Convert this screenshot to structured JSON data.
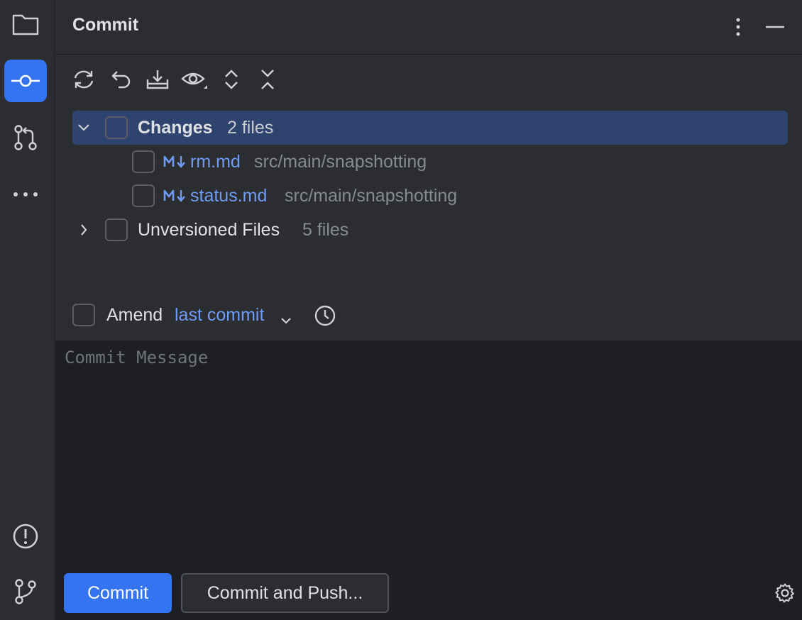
{
  "panel": {
    "title": "Commit"
  },
  "tree": {
    "changes": {
      "label": "Changes",
      "count": "2 files"
    },
    "files": [
      {
        "name": "rm.md",
        "path": "src/main/snapshotting"
      },
      {
        "name": "status.md",
        "path": "src/main/snapshotting"
      }
    ],
    "unversioned": {
      "label": "Unversioned Files",
      "count": "5 files"
    }
  },
  "amend": {
    "label": "Amend",
    "link": "last commit"
  },
  "message": {
    "placeholder": "Commit Message"
  },
  "buttons": {
    "commit": "Commit",
    "commit_push": "Commit and Push..."
  },
  "colors": {
    "accent": "#3574f0",
    "link": "#6e9bf5",
    "selection": "#2e436e"
  }
}
